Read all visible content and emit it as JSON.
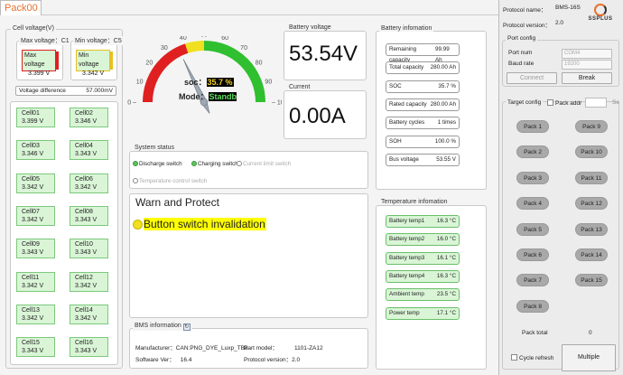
{
  "tab": {
    "label": "Pack00"
  },
  "cell_voltage": {
    "title": "Cell voltage(V)",
    "max_title": "Max voltage：C1",
    "max_label": "Max voltage",
    "max_value": "3.399 V",
    "min_title": "Min voltage：C5",
    "min_label": "Min voltage",
    "min_value": "3.342 V",
    "diff_label": "Voltage difference",
    "diff_value": "57.000mV",
    "cells": [
      {
        "name": "Cell01",
        "value": "3.399 V"
      },
      {
        "name": "Cell02",
        "value": "3.346 V"
      },
      {
        "name": "Cell03",
        "value": "3.346 V"
      },
      {
        "name": "Cell04",
        "value": "3.343 V"
      },
      {
        "name": "Cell05",
        "value": "3.342 V"
      },
      {
        "name": "Cell06",
        "value": "3.342 V"
      },
      {
        "name": "Cell07",
        "value": "3.342 V"
      },
      {
        "name": "Cell08",
        "value": "3.343 V"
      },
      {
        "name": "Cell09",
        "value": "3.343 V"
      },
      {
        "name": "Cell10",
        "value": "3.343 V"
      },
      {
        "name": "Cell11",
        "value": "3.342 V"
      },
      {
        "name": "Cell12",
        "value": "3.342 V"
      },
      {
        "name": "Cell13",
        "value": "3.342 V"
      },
      {
        "name": "Cell14",
        "value": "3.342 V"
      },
      {
        "name": "Cell15",
        "value": "3.343 V"
      },
      {
        "name": "Cell16",
        "value": "3.343 V"
      }
    ]
  },
  "gauge": {
    "ticks": [
      "0",
      "10",
      "20",
      "30",
      "40",
      "50",
      "60",
      "70",
      "80",
      "90",
      "100"
    ],
    "soc_label": "soc：",
    "soc_value": "35.7 %",
    "soc_percent": 35.7,
    "mode_label": "Mode：",
    "mode_value": "Standby"
  },
  "battery_voltage": {
    "title": "Battery voltage",
    "value": "53.54V"
  },
  "current": {
    "title": "Current",
    "value": "0.00A"
  },
  "battery_info": {
    "title": "Battery infomation",
    "rows": [
      {
        "label": "Remaining capacity",
        "value": "99.99 Ah"
      },
      {
        "label": "Total capacity",
        "value": "280.00 Ah"
      },
      {
        "label": "SOC",
        "value": "35.7 %"
      },
      {
        "label": "Rated capacity",
        "value": "280.00 Ah"
      },
      {
        "label": "Battery cycles",
        "value": "1 times"
      },
      {
        "label": "SOH",
        "value": "100.0 %"
      },
      {
        "label": "Bus voltage",
        "value": "53.55 V"
      }
    ]
  },
  "system_status": {
    "title": "System status",
    "items": [
      {
        "label": "Discharge switch",
        "on": true
      },
      {
        "label": "Charging switch",
        "on": true
      },
      {
        "label": "Current limit switch",
        "on": false
      },
      {
        "label": "Temperature control switch",
        "on": false
      }
    ]
  },
  "warn": {
    "title": "Warn and Protect",
    "message": "Button switch invalidation"
  },
  "temp_info": {
    "title": "Temperature infomation",
    "rows": [
      {
        "label": "Battery temp1",
        "value": "16.3 °C"
      },
      {
        "label": "Battery temp2",
        "value": "16.0 °C"
      },
      {
        "label": "Battery temp3",
        "value": "16.1 °C"
      },
      {
        "label": "Battery temp4",
        "value": "16.3 °C"
      },
      {
        "label": "Ambient temp",
        "value": "23.5 °C"
      },
      {
        "label": "Power temp",
        "value": "17.1 °C"
      }
    ]
  },
  "bms_info": {
    "title": "BMS information",
    "manufacturer_label": "Manufacturer：",
    "manufacturer_value": "CAN:PNG_DYE_Luxp_TB8",
    "part_label": "Part model：",
    "part_value": "1101-ZA12",
    "software_label": "Software Ver：",
    "software_value": "16.4",
    "protocol_label": "Protocol version：",
    "protocol_value": "2.0"
  },
  "side": {
    "protocol_name_label": "Protocol name：",
    "protocol_name_value": "BMS-16S",
    "protocol_version_label": "Protocol version：",
    "protocol_version_value": "2.0",
    "logo_text": "SSPLUS",
    "port_config_title": "Port config",
    "port_num_label": "Port num",
    "port_num_value": "COM4",
    "baud_label": "Baud rate",
    "baud_value": "19200",
    "connect_label": "Connect",
    "break_label": "Break",
    "target_config_title": "Target config",
    "pack_addr_label": "Pack addr",
    "se_label": "Se",
    "packs": [
      "Pack 1",
      "Pack 9",
      "Pack 2",
      "Pack 10",
      "Pack 3",
      "Pack 11",
      "Pack 4",
      "Pack 12",
      "Pack 5",
      "Pack 13",
      "Pack 6",
      "Pack 14",
      "Pack 7",
      "Pack 15",
      "Pack 8"
    ],
    "pack_total_label": "Pack total",
    "pack_total_value": "0",
    "cycle_refresh_label": "Cycle refresh",
    "multiple_label": "Multiple"
  },
  "colors": {
    "accent": "#e8712a",
    "cell_green": "#d9f5d6",
    "warn_yellow": "#ffff00",
    "gauge_red": "#e02020",
    "gauge_yellow": "#f0e020",
    "gauge_green": "#2fbf2f"
  }
}
